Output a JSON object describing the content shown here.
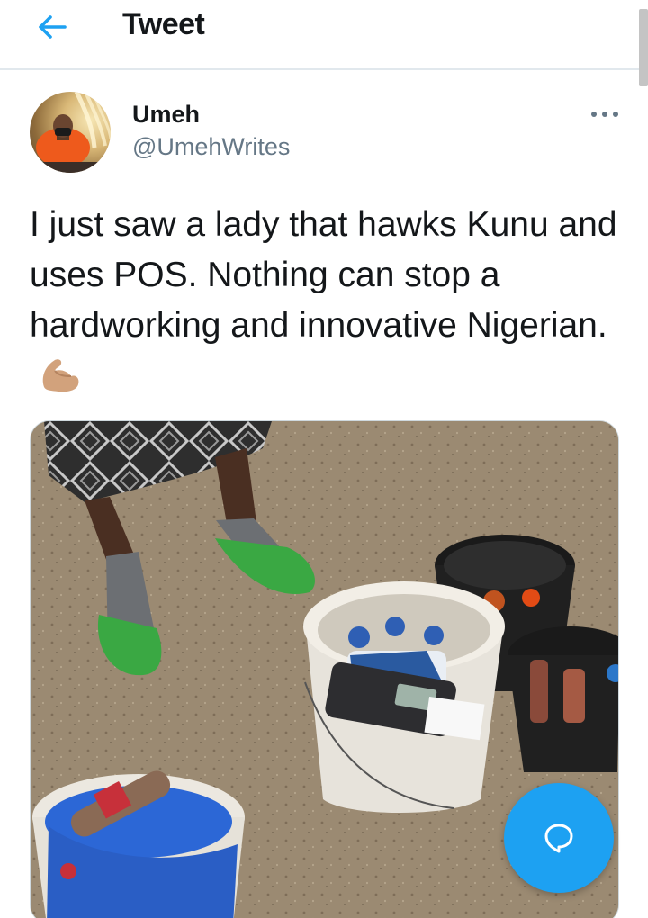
{
  "header": {
    "title": "Tweet",
    "back_icon": "arrow-left-icon"
  },
  "tweet": {
    "author_name": "Umeh",
    "author_handle": "@UmehWrites",
    "text": "I just saw a lady that hawks Kunu and uses POS. Nothing can stop a hardworking and innovative Nigerian.",
    "emoji": "flexed-biceps-emoji",
    "more_icon": "more-horizontal-icon",
    "media_icon": "photo"
  },
  "fab": {
    "icon": "reply-bubble-icon"
  },
  "colors": {
    "accent": "#1da1f2",
    "text_primary": "#14171a",
    "text_secondary": "#657786",
    "divider": "#e1e8ed"
  }
}
